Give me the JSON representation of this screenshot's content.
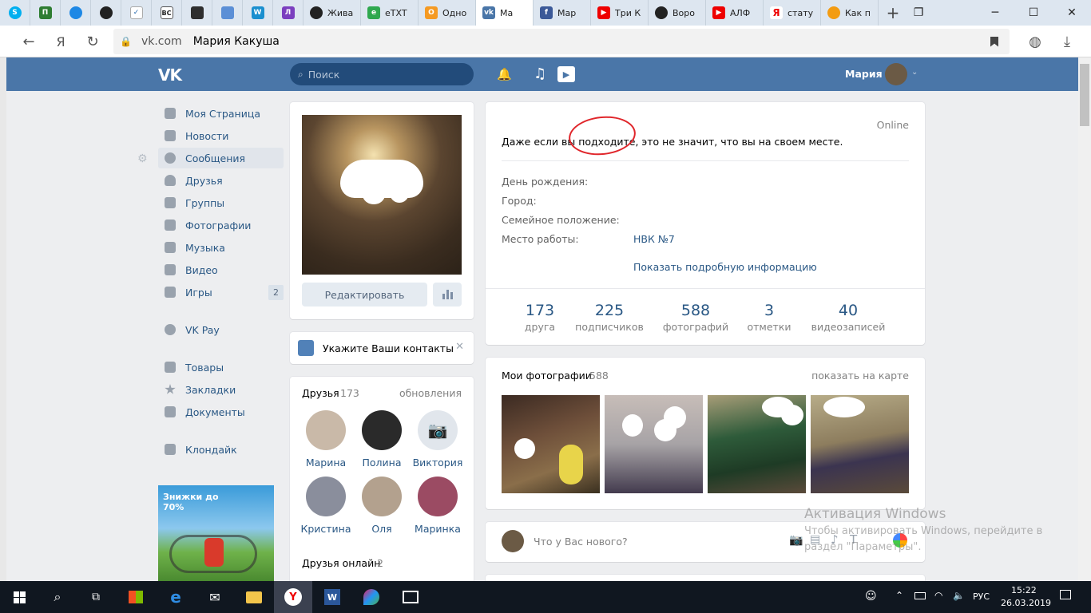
{
  "browser": {
    "tabs": [
      {
        "label": "Жива"
      },
      {
        "label": "eTXT"
      },
      {
        "label": "Одно"
      },
      {
        "label": "Ма"
      },
      {
        "label": "Мар"
      },
      {
        "label": "Три К"
      },
      {
        "label": "Воро"
      },
      {
        "label": "АЛФ"
      },
      {
        "label": "стату"
      },
      {
        "label": "Как п"
      }
    ],
    "address": {
      "domain": "vk.com",
      "title": "Мария Какуша"
    }
  },
  "vk_header": {
    "search_placeholder": "Поиск",
    "user_name": "Мария"
  },
  "sidebar": {
    "items": [
      {
        "label": "Моя Страница"
      },
      {
        "label": "Новости"
      },
      {
        "label": "Сообщения"
      },
      {
        "label": "Друзья"
      },
      {
        "label": "Группы"
      },
      {
        "label": "Фотографии"
      },
      {
        "label": "Музыка"
      },
      {
        "label": "Видео"
      },
      {
        "label": "Игры",
        "badge": "2"
      },
      {
        "label": "VK Pay"
      },
      {
        "label": "Товары"
      },
      {
        "label": "Закладки"
      },
      {
        "label": "Документы"
      },
      {
        "label": "Клондайк"
      }
    ],
    "ad_text": "Знижки до 70%"
  },
  "profile": {
    "edit_button": "Редактировать",
    "contacts_prompt": "Укажите Ваши контакты",
    "online": "Online",
    "status": "Даже если вы подходите, это не значит, что вы на своем месте.",
    "info": [
      {
        "label": "День рождения:",
        "value": ""
      },
      {
        "label": "Город:",
        "value": ""
      },
      {
        "label": "Семейное положение:",
        "value": ""
      },
      {
        "label": "Место работы:",
        "value": "НВК №7"
      }
    ],
    "more_info": "Показать подробную информацию",
    "counters": [
      {
        "num": "173",
        "label": "друга"
      },
      {
        "num": "225",
        "label": "подписчиков"
      },
      {
        "num": "588",
        "label": "фотографий"
      },
      {
        "num": "3",
        "label": "отметки"
      },
      {
        "num": "40",
        "label": "видеозаписей"
      }
    ]
  },
  "friends": {
    "title": "Друзья",
    "count": "173",
    "updates": "обновления",
    "list": [
      {
        "name": "Марина"
      },
      {
        "name": "Полина"
      },
      {
        "name": "Виктория"
      },
      {
        "name": "Кристина"
      },
      {
        "name": "Оля"
      },
      {
        "name": "Маринка"
      }
    ],
    "online_title": "Друзья онлайн",
    "online_count": "2"
  },
  "photos": {
    "title": "Мои фотографии",
    "count": "588",
    "map_link": "показать на карте"
  },
  "post_box": {
    "placeholder": "Что у Вас нового?"
  },
  "watermark": {
    "line1": "Активация Windows",
    "line2": "Чтобы активировать Windows, перейдите в",
    "line3": "раздел \"Параметры\"."
  },
  "taskbar": {
    "lang": "РУС",
    "time": "15:22",
    "date": "26.03.2019"
  },
  "colors": {
    "vk_blue": "#4a76a8",
    "link": "#2a5885",
    "annotation_red": "#e0262b"
  }
}
